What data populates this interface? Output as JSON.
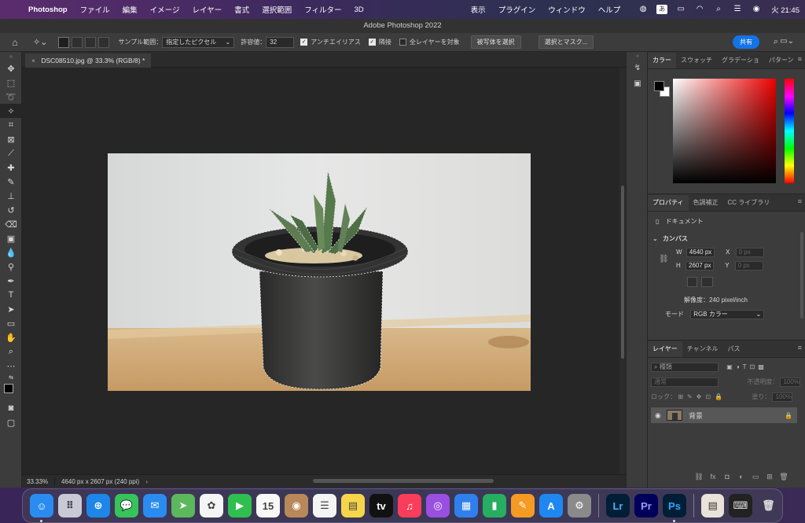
{
  "menubar": {
    "apple": "",
    "app_name": "Photoshop",
    "menus": [
      "ファイル",
      "編集",
      "イメージ",
      "レイヤー",
      "書式",
      "選択範囲",
      "フィルター",
      "3D"
    ],
    "right_menus": [
      "表示",
      "プラグイン",
      "ウィンドウ",
      "ヘルプ"
    ],
    "clock": "火 21:45",
    "ime_label": "あ"
  },
  "titlebar": {
    "title": "Adobe Photoshop 2022"
  },
  "optbar": {
    "sample_label": "サンプル範囲：",
    "sample_value": "指定したピクセル",
    "tolerance_label": "許容値：",
    "tolerance_value": "32",
    "antialias": "アンチエイリアス",
    "contiguous": "隣接",
    "all_layers": "全レイヤーを対象",
    "select_subject": "被写体を選択",
    "select_mask": "選択とマスク...",
    "share": "共有"
  },
  "document": {
    "tab_label": "DSC08510.jpg @ 33.3% (RGB/8) *",
    "zoom": "33.33%",
    "info": "4640 px x 2607 px (240 ppi)"
  },
  "color_panel": {
    "tabs": [
      "カラー",
      "スウォッチ",
      "グラデーショ",
      "パターン"
    ],
    "foreground": "#000000",
    "background": "#ffffff"
  },
  "properties_panel": {
    "tabs": [
      "プロパティ",
      "色調補正",
      "CC ライブラリ"
    ],
    "type_label": "ドキュメント",
    "section": "カンバス",
    "w_label": "W",
    "w_value": "4640 px",
    "h_label": "H",
    "h_value": "2607 px",
    "x_label": "X",
    "x_value": "0 px",
    "y_label": "Y",
    "y_value": "0 px",
    "resolution": "解像度：240 pixel/inch",
    "mode_label": "モード",
    "mode_value": "RGB カラー"
  },
  "layers_panel": {
    "tabs": [
      "レイヤー",
      "チャンネル",
      "パス"
    ],
    "filter_placeholder": "種類",
    "blend_mode": "通常",
    "opacity_label": "不透明度：",
    "opacity_value": "100%",
    "lock_label": "ロック：",
    "fill_label": "塗り：",
    "fill_value": "100%",
    "layer_name": "背景"
  },
  "dock": {
    "apps": [
      {
        "name": "Finder",
        "color": "#2a8cf0",
        "glyph": "☺"
      },
      {
        "name": "Launchpad",
        "color": "#c9c9d6",
        "glyph": "⠿"
      },
      {
        "name": "Safari",
        "color": "#1e86e8",
        "glyph": "⊕"
      },
      {
        "name": "Messages",
        "color": "#36c35a",
        "glyph": "💬"
      },
      {
        "name": "Mail",
        "color": "#2a8cf0",
        "glyph": "✉"
      },
      {
        "name": "Maps",
        "color": "#5cb85c",
        "glyph": "➤"
      },
      {
        "name": "Photos",
        "color": "#f5f5f5",
        "glyph": "✿"
      },
      {
        "name": "FaceTime",
        "color": "#2fbf4f",
        "glyph": "▶"
      },
      {
        "name": "Calendar",
        "color": "#f8f8f8",
        "glyph": "15"
      },
      {
        "name": "Contacts",
        "color": "#b8875a",
        "glyph": "◉"
      },
      {
        "name": "Reminders",
        "color": "#f4f4f4",
        "glyph": "☰"
      },
      {
        "name": "Notes",
        "color": "#f6d54a",
        "glyph": "▤"
      },
      {
        "name": "TV",
        "color": "#111111",
        "glyph": "tv"
      },
      {
        "name": "Music",
        "color": "#fa3d5a",
        "glyph": "♫"
      },
      {
        "name": "Podcasts",
        "color": "#9a4fe0",
        "glyph": "◎"
      },
      {
        "name": "Keynote",
        "color": "#2f80ed",
        "glyph": "▦"
      },
      {
        "name": "Numbers",
        "color": "#27ae60",
        "glyph": "▮"
      },
      {
        "name": "Pages",
        "color": "#f59a23",
        "glyph": "✎"
      },
      {
        "name": "App Store",
        "color": "#1e88f0",
        "glyph": "A"
      },
      {
        "name": "System Preferences",
        "color": "#8a8a8a",
        "glyph": "⚙"
      }
    ],
    "adobe_apps": [
      {
        "name": "Lightroom",
        "color": "#001e36",
        "fg": "#4ab0ff",
        "glyph": "Lr"
      },
      {
        "name": "Premiere Pro",
        "color": "#00005b",
        "fg": "#9999ff",
        "glyph": "Pr"
      },
      {
        "name": "Photoshop",
        "color": "#001e36",
        "fg": "#31a8ff",
        "glyph": "Ps"
      }
    ]
  }
}
